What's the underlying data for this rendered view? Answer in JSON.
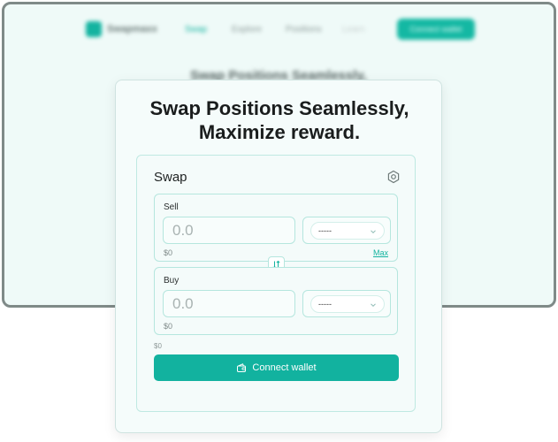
{
  "background": {
    "nav": {
      "brand": "Swapmaxx",
      "links": [
        "Swap",
        "Explore",
        "Positions",
        "Learn"
      ],
      "cta": "Connect wallet"
    },
    "headline": "Swap Positions Seamlessly,"
  },
  "hero": {
    "title_line1": "Swap Positions Seamlessly,",
    "title_line2": "Maximize reward."
  },
  "swap": {
    "title": "Swap",
    "settings_icon": "gear-icon",
    "sell": {
      "label": "Sell",
      "amount_placeholder": "0.0",
      "token": "-----",
      "usd_value": "$0",
      "max_label": "Max"
    },
    "switch_icon": "arrows-up-down-icon",
    "buy": {
      "label": "Buy",
      "amount_placeholder": "0.0",
      "token": "-----",
      "usd_value": "$0"
    },
    "total_usd": "$0",
    "connect_button": {
      "label": "Connect wallet",
      "icon": "wallet-icon"
    }
  },
  "colors": {
    "accent": "#12b29f",
    "card_background": "#f5fcfb",
    "border": "#b5e6de"
  }
}
